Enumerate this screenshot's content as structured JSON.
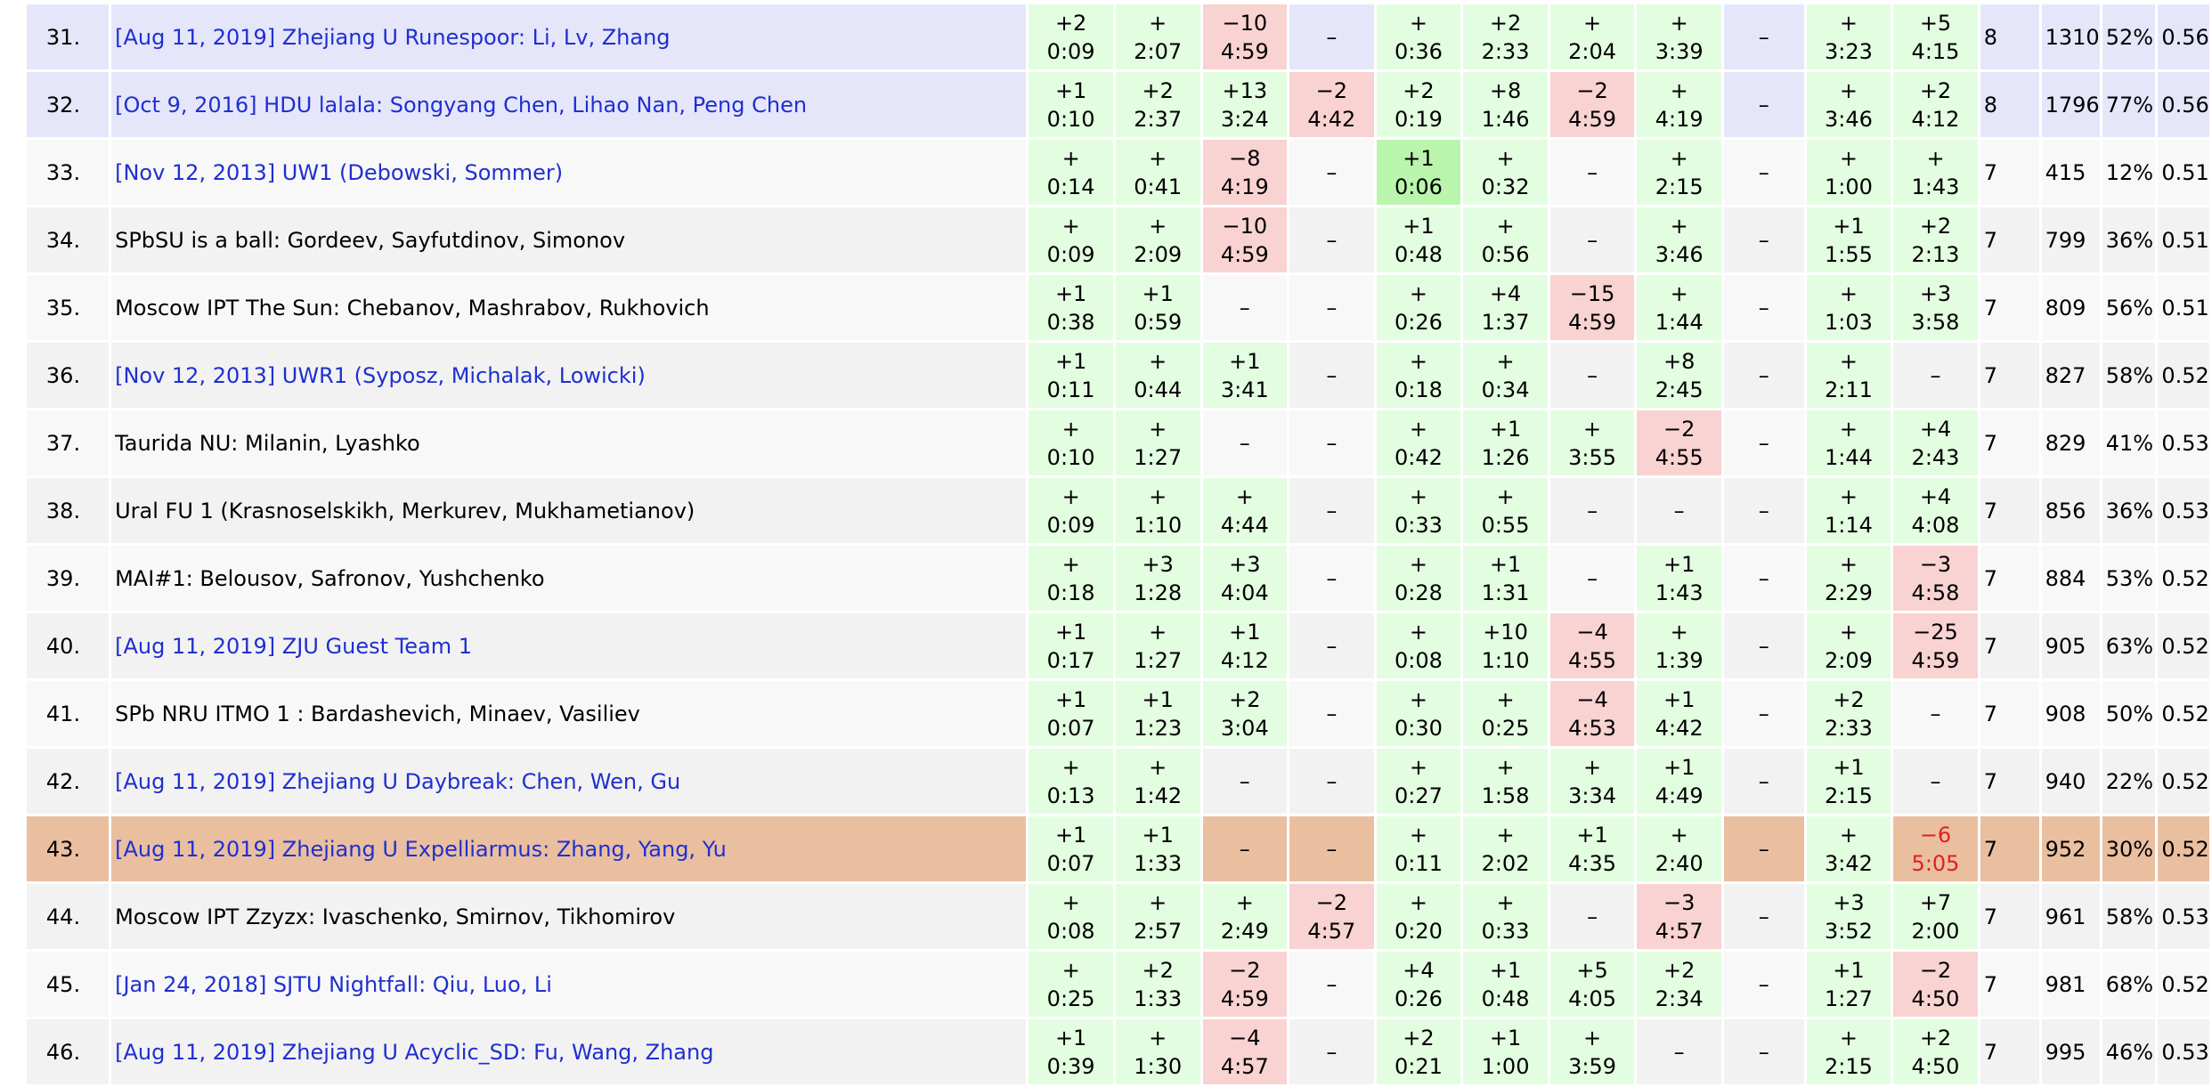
{
  "standings": [
    {
      "rank": "31.",
      "team": "[Aug 11, 2019] Zhejiang U Runespoor: Li, Lv, Zhang",
      "link": true,
      "style": "hl",
      "problems": [
        {
          "s": "ac",
          "a": "+2",
          "t": "0:09"
        },
        {
          "s": "ac",
          "a": "+",
          "t": "2:07"
        },
        {
          "s": "wa",
          "a": "−10",
          "t": "4:59"
        },
        {
          "s": "none",
          "a": "–",
          "t": ""
        },
        {
          "s": "ac",
          "a": "+",
          "t": "0:36"
        },
        {
          "s": "ac",
          "a": "+2",
          "t": "2:33"
        },
        {
          "s": "ac",
          "a": "+",
          "t": "2:04"
        },
        {
          "s": "ac",
          "a": "+",
          "t": "3:39"
        },
        {
          "s": "none",
          "a": "–",
          "t": ""
        },
        {
          "s": "ac",
          "a": "+",
          "t": "3:23"
        },
        {
          "s": "ac",
          "a": "+5",
          "t": "4:15"
        }
      ],
      "solved": "8",
      "penalty": "1310",
      "pct": "52%",
      "ratio": "0.56"
    },
    {
      "rank": "32.",
      "team": "[Oct 9, 2016] HDU lalala: Songyang Chen, Lihao Nan, Peng Chen",
      "link": true,
      "style": "hl",
      "problems": [
        {
          "s": "ac",
          "a": "+1",
          "t": "0:10"
        },
        {
          "s": "ac",
          "a": "+2",
          "t": "2:37"
        },
        {
          "s": "ac",
          "a": "+13",
          "t": "3:24"
        },
        {
          "s": "wa",
          "a": "−2",
          "t": "4:42"
        },
        {
          "s": "ac",
          "a": "+2",
          "t": "0:19"
        },
        {
          "s": "ac",
          "a": "+8",
          "t": "1:46"
        },
        {
          "s": "wa",
          "a": "−2",
          "t": "4:59"
        },
        {
          "s": "ac",
          "a": "+",
          "t": "4:19"
        },
        {
          "s": "none",
          "a": "–",
          "t": ""
        },
        {
          "s": "ac",
          "a": "+",
          "t": "3:46"
        },
        {
          "s": "ac",
          "a": "+2",
          "t": "4:12"
        }
      ],
      "solved": "8",
      "penalty": "1796",
      "pct": "77%",
      "ratio": "0.56"
    },
    {
      "rank": "33.",
      "team": "[Nov 12, 2013] UW1 (Debowski, Sommer)",
      "link": true,
      "style": "odd",
      "problems": [
        {
          "s": "ac",
          "a": "+",
          "t": "0:14"
        },
        {
          "s": "ac",
          "a": "+",
          "t": "0:41"
        },
        {
          "s": "wa",
          "a": "−8",
          "t": "4:19"
        },
        {
          "s": "none",
          "a": "–",
          "t": ""
        },
        {
          "s": "first",
          "a": "+1",
          "t": "0:06"
        },
        {
          "s": "ac",
          "a": "+",
          "t": "0:32"
        },
        {
          "s": "none",
          "a": "–",
          "t": ""
        },
        {
          "s": "ac",
          "a": "+",
          "t": "2:15"
        },
        {
          "s": "none",
          "a": "–",
          "t": ""
        },
        {
          "s": "ac",
          "a": "+",
          "t": "1:00"
        },
        {
          "s": "ac",
          "a": "+",
          "t": "1:43"
        }
      ],
      "solved": "7",
      "penalty": "415",
      "pct": "12%",
      "ratio": "0.51"
    },
    {
      "rank": "34.",
      "team": "SPbSU is a ball: Gordeev, Sayfutdinov, Simonov",
      "link": false,
      "style": "even",
      "problems": [
        {
          "s": "ac",
          "a": "+",
          "t": "0:09"
        },
        {
          "s": "ac",
          "a": "+",
          "t": "2:09"
        },
        {
          "s": "wa",
          "a": "−10",
          "t": "4:59"
        },
        {
          "s": "none",
          "a": "–",
          "t": ""
        },
        {
          "s": "ac",
          "a": "+1",
          "t": "0:48"
        },
        {
          "s": "ac",
          "a": "+",
          "t": "0:56"
        },
        {
          "s": "none",
          "a": "–",
          "t": ""
        },
        {
          "s": "ac",
          "a": "+",
          "t": "3:46"
        },
        {
          "s": "none",
          "a": "–",
          "t": ""
        },
        {
          "s": "ac",
          "a": "+1",
          "t": "1:55"
        },
        {
          "s": "ac",
          "a": "+2",
          "t": "2:13"
        }
      ],
      "solved": "7",
      "penalty": "799",
      "pct": "36%",
      "ratio": "0.51"
    },
    {
      "rank": "35.",
      "team": "Moscow IPT The Sun: Chebanov, Mashrabov, Rukhovich",
      "link": false,
      "style": "odd",
      "problems": [
        {
          "s": "ac",
          "a": "+1",
          "t": "0:38"
        },
        {
          "s": "ac",
          "a": "+1",
          "t": "0:59"
        },
        {
          "s": "none",
          "a": "–",
          "t": ""
        },
        {
          "s": "none",
          "a": "–",
          "t": ""
        },
        {
          "s": "ac",
          "a": "+",
          "t": "0:26"
        },
        {
          "s": "ac",
          "a": "+4",
          "t": "1:37"
        },
        {
          "s": "wa",
          "a": "−15",
          "t": "4:59"
        },
        {
          "s": "ac",
          "a": "+",
          "t": "1:44"
        },
        {
          "s": "none",
          "a": "–",
          "t": ""
        },
        {
          "s": "ac",
          "a": "+",
          "t": "1:03"
        },
        {
          "s": "ac",
          "a": "+3",
          "t": "3:58"
        }
      ],
      "solved": "7",
      "penalty": "809",
      "pct": "56%",
      "ratio": "0.51"
    },
    {
      "rank": "36.",
      "team": "[Nov 12, 2013] UWR1 (Syposz, Michalak, Lowicki)",
      "link": true,
      "style": "even",
      "problems": [
        {
          "s": "ac",
          "a": "+1",
          "t": "0:11"
        },
        {
          "s": "ac",
          "a": "+",
          "t": "0:44"
        },
        {
          "s": "ac",
          "a": "+1",
          "t": "3:41"
        },
        {
          "s": "none",
          "a": "–",
          "t": ""
        },
        {
          "s": "ac",
          "a": "+",
          "t": "0:18"
        },
        {
          "s": "ac",
          "a": "+",
          "t": "0:34"
        },
        {
          "s": "none",
          "a": "–",
          "t": ""
        },
        {
          "s": "ac",
          "a": "+8",
          "t": "2:45"
        },
        {
          "s": "none",
          "a": "–",
          "t": ""
        },
        {
          "s": "ac",
          "a": "+",
          "t": "2:11"
        },
        {
          "s": "none",
          "a": "–",
          "t": ""
        }
      ],
      "solved": "7",
      "penalty": "827",
      "pct": "58%",
      "ratio": "0.52"
    },
    {
      "rank": "37.",
      "team": "Taurida NU: Milanin, Lyashko",
      "link": false,
      "style": "odd",
      "problems": [
        {
          "s": "ac",
          "a": "+",
          "t": "0:10"
        },
        {
          "s": "ac",
          "a": "+",
          "t": "1:27"
        },
        {
          "s": "none",
          "a": "–",
          "t": ""
        },
        {
          "s": "none",
          "a": "–",
          "t": ""
        },
        {
          "s": "ac",
          "a": "+",
          "t": "0:42"
        },
        {
          "s": "ac",
          "a": "+1",
          "t": "1:26"
        },
        {
          "s": "ac",
          "a": "+",
          "t": "3:55"
        },
        {
          "s": "wa",
          "a": "−2",
          "t": "4:55"
        },
        {
          "s": "none",
          "a": "–",
          "t": ""
        },
        {
          "s": "ac",
          "a": "+",
          "t": "1:44"
        },
        {
          "s": "ac",
          "a": "+4",
          "t": "2:43"
        }
      ],
      "solved": "7",
      "penalty": "829",
      "pct": "41%",
      "ratio": "0.53"
    },
    {
      "rank": "38.",
      "team": "Ural FU 1 (Krasnoselskikh, Merkurev, Mukhametianov)",
      "link": false,
      "style": "even",
      "problems": [
        {
          "s": "ac",
          "a": "+",
          "t": "0:09"
        },
        {
          "s": "ac",
          "a": "+",
          "t": "1:10"
        },
        {
          "s": "ac",
          "a": "+",
          "t": "4:44"
        },
        {
          "s": "none",
          "a": "–",
          "t": ""
        },
        {
          "s": "ac",
          "a": "+",
          "t": "0:33"
        },
        {
          "s": "ac",
          "a": "+",
          "t": "0:55"
        },
        {
          "s": "none",
          "a": "–",
          "t": ""
        },
        {
          "s": "none",
          "a": "–",
          "t": ""
        },
        {
          "s": "none",
          "a": "–",
          "t": ""
        },
        {
          "s": "ac",
          "a": "+",
          "t": "1:14"
        },
        {
          "s": "ac",
          "a": "+4",
          "t": "4:08"
        }
      ],
      "solved": "7",
      "penalty": "856",
      "pct": "36%",
      "ratio": "0.53"
    },
    {
      "rank": "39.",
      "team": "MAI#1: Belousov, Safronov, Yushchenko",
      "link": false,
      "style": "odd",
      "problems": [
        {
          "s": "ac",
          "a": "+",
          "t": "0:18"
        },
        {
          "s": "ac",
          "a": "+3",
          "t": "1:28"
        },
        {
          "s": "ac",
          "a": "+3",
          "t": "4:04"
        },
        {
          "s": "none",
          "a": "–",
          "t": ""
        },
        {
          "s": "ac",
          "a": "+",
          "t": "0:28"
        },
        {
          "s": "ac",
          "a": "+1",
          "t": "1:31"
        },
        {
          "s": "none",
          "a": "–",
          "t": ""
        },
        {
          "s": "ac",
          "a": "+1",
          "t": "1:43"
        },
        {
          "s": "none",
          "a": "–",
          "t": ""
        },
        {
          "s": "ac",
          "a": "+",
          "t": "2:29"
        },
        {
          "s": "wa",
          "a": "−3",
          "t": "4:58"
        }
      ],
      "solved": "7",
      "penalty": "884",
      "pct": "53%",
      "ratio": "0.52"
    },
    {
      "rank": "40.",
      "team": "[Aug 11, 2019] ZJU Guest Team 1",
      "link": true,
      "style": "even",
      "problems": [
        {
          "s": "ac",
          "a": "+1",
          "t": "0:17"
        },
        {
          "s": "ac",
          "a": "+",
          "t": "1:27"
        },
        {
          "s": "ac",
          "a": "+1",
          "t": "4:12"
        },
        {
          "s": "none",
          "a": "–",
          "t": ""
        },
        {
          "s": "ac",
          "a": "+",
          "t": "0:08"
        },
        {
          "s": "ac",
          "a": "+10",
          "t": "1:10"
        },
        {
          "s": "wa",
          "a": "−4",
          "t": "4:55"
        },
        {
          "s": "ac",
          "a": "+",
          "t": "1:39"
        },
        {
          "s": "none",
          "a": "–",
          "t": ""
        },
        {
          "s": "ac",
          "a": "+",
          "t": "2:09"
        },
        {
          "s": "wa",
          "a": "−25",
          "t": "4:59"
        }
      ],
      "solved": "7",
      "penalty": "905",
      "pct": "63%",
      "ratio": "0.52"
    },
    {
      "rank": "41.",
      "team": "SPb NRU ITMO 1 : Bardashevich, Minaev, Vasiliev",
      "link": false,
      "style": "odd",
      "problems": [
        {
          "s": "ac",
          "a": "+1",
          "t": "0:07"
        },
        {
          "s": "ac",
          "a": "+1",
          "t": "1:23"
        },
        {
          "s": "ac",
          "a": "+2",
          "t": "3:04"
        },
        {
          "s": "none",
          "a": "–",
          "t": ""
        },
        {
          "s": "ac",
          "a": "+",
          "t": "0:30"
        },
        {
          "s": "ac",
          "a": "+",
          "t": "0:25"
        },
        {
          "s": "wa",
          "a": "−4",
          "t": "4:53"
        },
        {
          "s": "ac",
          "a": "+1",
          "t": "4:42"
        },
        {
          "s": "none",
          "a": "–",
          "t": ""
        },
        {
          "s": "ac",
          "a": "+2",
          "t": "2:33"
        },
        {
          "s": "none",
          "a": "–",
          "t": ""
        }
      ],
      "solved": "7",
      "penalty": "908",
      "pct": "50%",
      "ratio": "0.52"
    },
    {
      "rank": "42.",
      "team": "[Aug 11, 2019] Zhejiang U Daybreak: Chen, Wen, Gu",
      "link": true,
      "style": "even",
      "problems": [
        {
          "s": "ac",
          "a": "+",
          "t": "0:13"
        },
        {
          "s": "ac",
          "a": "+",
          "t": "1:42"
        },
        {
          "s": "none",
          "a": "–",
          "t": ""
        },
        {
          "s": "none",
          "a": "–",
          "t": ""
        },
        {
          "s": "ac",
          "a": "+",
          "t": "0:27"
        },
        {
          "s": "ac",
          "a": "+",
          "t": "1:58"
        },
        {
          "s": "ac",
          "a": "+",
          "t": "3:34"
        },
        {
          "s": "ac",
          "a": "+1",
          "t": "4:49"
        },
        {
          "s": "none",
          "a": "–",
          "t": ""
        },
        {
          "s": "ac",
          "a": "+1",
          "t": "2:15"
        },
        {
          "s": "none",
          "a": "–",
          "t": ""
        }
      ],
      "solved": "7",
      "penalty": "940",
      "pct": "22%",
      "ratio": "0.52"
    },
    {
      "rank": "43.",
      "team": "[Aug 11, 2019] Zhejiang U Expelliarmus: Zhang, Yang, Yu",
      "link": true,
      "style": "mine",
      "problems": [
        {
          "s": "ac",
          "a": "+1",
          "t": "0:07"
        },
        {
          "s": "ac",
          "a": "+1",
          "t": "1:33"
        },
        {
          "s": "none",
          "a": "–",
          "t": ""
        },
        {
          "s": "none",
          "a": "–",
          "t": ""
        },
        {
          "s": "ac",
          "a": "+",
          "t": "0:11"
        },
        {
          "s": "ac",
          "a": "+",
          "t": "2:02"
        },
        {
          "s": "ac",
          "a": "+1",
          "t": "4:35"
        },
        {
          "s": "ac",
          "a": "+",
          "t": "2:40"
        },
        {
          "s": "none",
          "a": "–",
          "t": ""
        },
        {
          "s": "ac",
          "a": "+",
          "t": "3:42"
        },
        {
          "s": "pend",
          "a": "−6",
          "t": "5:05"
        }
      ],
      "solved": "7",
      "penalty": "952",
      "pct": "30%",
      "ratio": "0.52"
    },
    {
      "rank": "44.",
      "team": "Moscow IPT Zzyzx: Ivaschenko, Smirnov, Tikhomirov",
      "link": false,
      "style": "even",
      "problems": [
        {
          "s": "ac",
          "a": "+",
          "t": "0:08"
        },
        {
          "s": "ac",
          "a": "+",
          "t": "2:57"
        },
        {
          "s": "ac",
          "a": "+",
          "t": "2:49"
        },
        {
          "s": "wa",
          "a": "−2",
          "t": "4:57"
        },
        {
          "s": "ac",
          "a": "+",
          "t": "0:20"
        },
        {
          "s": "ac",
          "a": "+",
          "t": "0:33"
        },
        {
          "s": "none",
          "a": "–",
          "t": ""
        },
        {
          "s": "wa",
          "a": "−3",
          "t": "4:57"
        },
        {
          "s": "none",
          "a": "–",
          "t": ""
        },
        {
          "s": "ac",
          "a": "+3",
          "t": "3:52"
        },
        {
          "s": "ac",
          "a": "+7",
          "t": "2:00"
        }
      ],
      "solved": "7",
      "penalty": "961",
      "pct": "58%",
      "ratio": "0.53"
    },
    {
      "rank": "45.",
      "team": "[Jan 24, 2018] SJTU Nightfall: Qiu, Luo, Li",
      "link": true,
      "style": "odd",
      "problems": [
        {
          "s": "ac",
          "a": "+",
          "t": "0:25"
        },
        {
          "s": "ac",
          "a": "+2",
          "t": "1:33"
        },
        {
          "s": "wa",
          "a": "−2",
          "t": "4:59"
        },
        {
          "s": "none",
          "a": "–",
          "t": ""
        },
        {
          "s": "ac",
          "a": "+4",
          "t": "0:26"
        },
        {
          "s": "ac",
          "a": "+1",
          "t": "0:48"
        },
        {
          "s": "ac",
          "a": "+5",
          "t": "4:05"
        },
        {
          "s": "ac",
          "a": "+2",
          "t": "2:34"
        },
        {
          "s": "none",
          "a": "–",
          "t": ""
        },
        {
          "s": "ac",
          "a": "+1",
          "t": "1:27"
        },
        {
          "s": "wa",
          "a": "−2",
          "t": "4:50"
        }
      ],
      "solved": "7",
      "penalty": "981",
      "pct": "68%",
      "ratio": "0.52"
    },
    {
      "rank": "46.",
      "team": "[Aug 11, 2019] Zhejiang U Acyclic_SD: Fu, Wang, Zhang",
      "link": true,
      "style": "even",
      "problems": [
        {
          "s": "ac",
          "a": "+1",
          "t": "0:39"
        },
        {
          "s": "ac",
          "a": "+",
          "t": "1:30"
        },
        {
          "s": "wa",
          "a": "−4",
          "t": "4:57"
        },
        {
          "s": "none",
          "a": "–",
          "t": ""
        },
        {
          "s": "ac",
          "a": "+2",
          "t": "0:21"
        },
        {
          "s": "ac",
          "a": "+1",
          "t": "1:00"
        },
        {
          "s": "ac",
          "a": "+",
          "t": "3:59"
        },
        {
          "s": "none",
          "a": "–",
          "t": ""
        },
        {
          "s": "none",
          "a": "–",
          "t": ""
        },
        {
          "s": "ac",
          "a": "+",
          "t": "2:15"
        },
        {
          "s": "ac",
          "a": "+2",
          "t": "4:50"
        }
      ],
      "solved": "7",
      "penalty": "995",
      "pct": "46%",
      "ratio": "0.53"
    }
  ]
}
